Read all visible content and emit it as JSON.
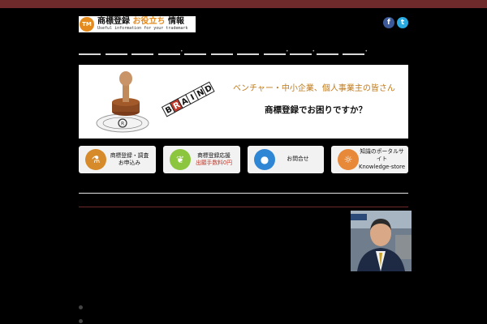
{
  "logo": {
    "mark": "TM",
    "title_part1": "商標登録",
    "title_accent": "お役立ち",
    "title_part2": "情報",
    "subtitle": "Useful information for your trademark"
  },
  "social": {
    "facebook": "f",
    "twitter": "t"
  },
  "nav_count": 11,
  "banner": {
    "line1": "ベンチャー・中小企業、個人事業主の皆さん",
    "line2": "商標登録でお困りですか？",
    "braid_letters": [
      "B",
      "R",
      "A",
      "I",
      "N",
      "D"
    ],
    "stamp_text": "REGISTERED"
  },
  "buttons": [
    {
      "line1": "商標登録・調査",
      "line2": "お申込み",
      "icon": "flask-icon"
    },
    {
      "line1": "商標登録応援",
      "line2": "出願手数料0円",
      "icon": "leaf-icon"
    },
    {
      "line1": "お問合せ",
      "line2": "",
      "icon": "globe-icon"
    },
    {
      "line1": "知識のポータルサイト",
      "line2": "Knowledge-store",
      "icon": "lamp-icon"
    }
  ],
  "colors": {
    "topbar": "#6e2a2a",
    "accent": "#e58a1d",
    "banner_text": "#c07a1b"
  }
}
